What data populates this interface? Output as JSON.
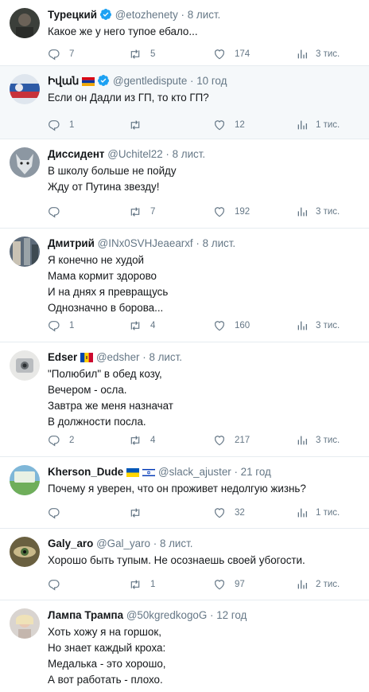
{
  "tweets": [
    {
      "name": "Турецкий",
      "handle": "@etozhenety",
      "time": "8 лист.",
      "lines": [
        "Какое же у него тупое ебало..."
      ],
      "replies": "7",
      "retweets": "5",
      "likes": "174",
      "views": "3 тис."
    },
    {
      "name": "Իվան",
      "handle": "@gentledispute",
      "time": "10 год",
      "lines": [
        "Если он Дадли из ГП, то кто ГП?"
      ],
      "replies": "1",
      "retweets": "",
      "likes": "12",
      "views": "1 тис."
    },
    {
      "name": "Диссидент",
      "handle": "@Uchitel22",
      "time": "8 лист.",
      "lines": [
        "В школу больше не пойду",
        "Жду от Путина звезду!"
      ],
      "replies": "",
      "retweets": "7",
      "likes": "192",
      "views": "3 тис."
    },
    {
      "name": "Дмитрий",
      "handle": "@INx0SVHJeaearxf",
      "time": "8 лист.",
      "lines": [
        "Я конечно не худой",
        "Мама кормит здорово",
        "И на днях я превращусь",
        "Однозначно в борова..."
      ],
      "replies": "1",
      "retweets": "4",
      "likes": "160",
      "views": "3 тис."
    },
    {
      "name": "Edser",
      "handle": "@edsher",
      "time": "8 лист.",
      "lines": [
        "\"Полюбил\" в обед козу,",
        "Вечером - осла.",
        "Завтра же меня назначат",
        "В должности посла."
      ],
      "replies": "2",
      "retweets": "4",
      "likes": "217",
      "views": "3 тис."
    },
    {
      "name": "Kherson_Dude",
      "handle": "@slack_ajuster",
      "time": "21 год",
      "lines": [
        "Почему я уверен, что он проживет недолгую жизнь?"
      ],
      "replies": "",
      "retweets": "",
      "likes": "32",
      "views": "1 тис."
    },
    {
      "name": "Galy_aro",
      "handle": "@Gal_yaro",
      "time": "8 лист.",
      "lines": [
        "Хорошо быть тупым. Не осознаешь своей убогости."
      ],
      "replies": "",
      "retweets": "1",
      "likes": "97",
      "views": "2 тис."
    },
    {
      "name": "Лампа Трампа",
      "handle": "@50kgredkogoG",
      "time": "12 год",
      "lines": [
        "Хоть хожу я на горшок,",
        "Но знает каждый кроха:",
        "Медалька - это хорошо,",
        "А вот работать - плохо."
      ],
      "replies": "",
      "retweets": "",
      "likes": "",
      "views": ""
    }
  ],
  "separator": "·",
  "colors": {
    "accent": "#1da1f2",
    "muted": "#657786",
    "divider": "#e6ecf0"
  },
  "icons": [
    "reply-icon",
    "retweet-icon",
    "like-icon",
    "views-icon",
    "verified-icon"
  ]
}
